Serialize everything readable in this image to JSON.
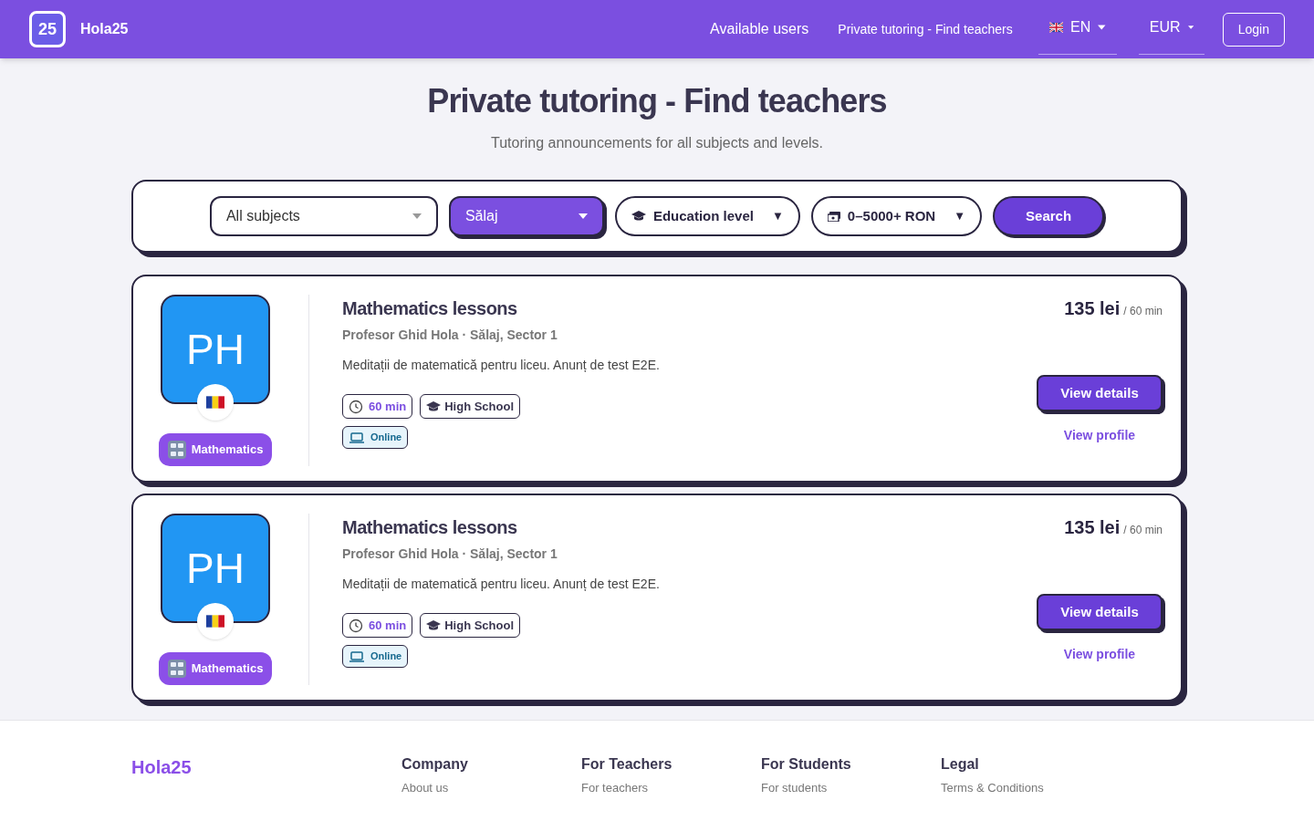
{
  "header": {
    "logo_text": "25",
    "brand": "Hola25",
    "nav": [
      {
        "label": "Available users",
        "kind": "link"
      },
      {
        "label": "Private tutoring - Find teachers",
        "kind": "link"
      },
      {
        "label": "EN",
        "kind": "language"
      },
      {
        "label": "EUR",
        "kind": "currency"
      }
    ],
    "login": "Login"
  },
  "page": {
    "title": "Private tutoring - Find teachers",
    "subtitle": "Tutoring announcements for all subjects and levels."
  },
  "filters": [
    {
      "kind": "select",
      "value": "All subjects",
      "selected": false
    },
    {
      "kind": "select",
      "value": "Sălaj",
      "selected": true
    },
    {
      "kind": "level",
      "value": "Education level",
      "caret": "▼"
    },
    {
      "kind": "price",
      "value": "0–5000+ RON",
      "caret": "▼"
    }
  ],
  "search_button": "Search",
  "listings": [
    {
      "initials": "PH",
      "subject": "Mathematics",
      "title": "Mathematics lessons",
      "author": "Profesor Ghid Hola · Sălaj, Sector 1",
      "description": "Meditații de matematică pentru liceu. Anunț de test E2E.",
      "duration": "60 min",
      "level": "High School",
      "mode": "Online",
      "price": "135 lei",
      "per": "/ 60 min",
      "details": "View details",
      "profile": "View profile"
    },
    {
      "initials": "PH",
      "subject": "Mathematics",
      "title": "Mathematics lessons",
      "author": "Profesor Ghid Hola · Sălaj, Sector 1",
      "description": "Meditații de matematică pentru liceu. Anunț de test E2E.",
      "duration": "60 min",
      "level": "High School",
      "mode": "Online",
      "price": "135 lei",
      "per": "/ 60 min",
      "details": "View details",
      "profile": "View profile"
    }
  ],
  "footer": {
    "brand": "Hola25",
    "columns": [
      {
        "heading": "Company",
        "link": "About us"
      },
      {
        "heading": "For Teachers",
        "link": "For teachers"
      },
      {
        "heading": "For Students",
        "link": "For students"
      },
      {
        "heading": "Legal",
        "link": "Terms & Conditions"
      }
    ]
  }
}
